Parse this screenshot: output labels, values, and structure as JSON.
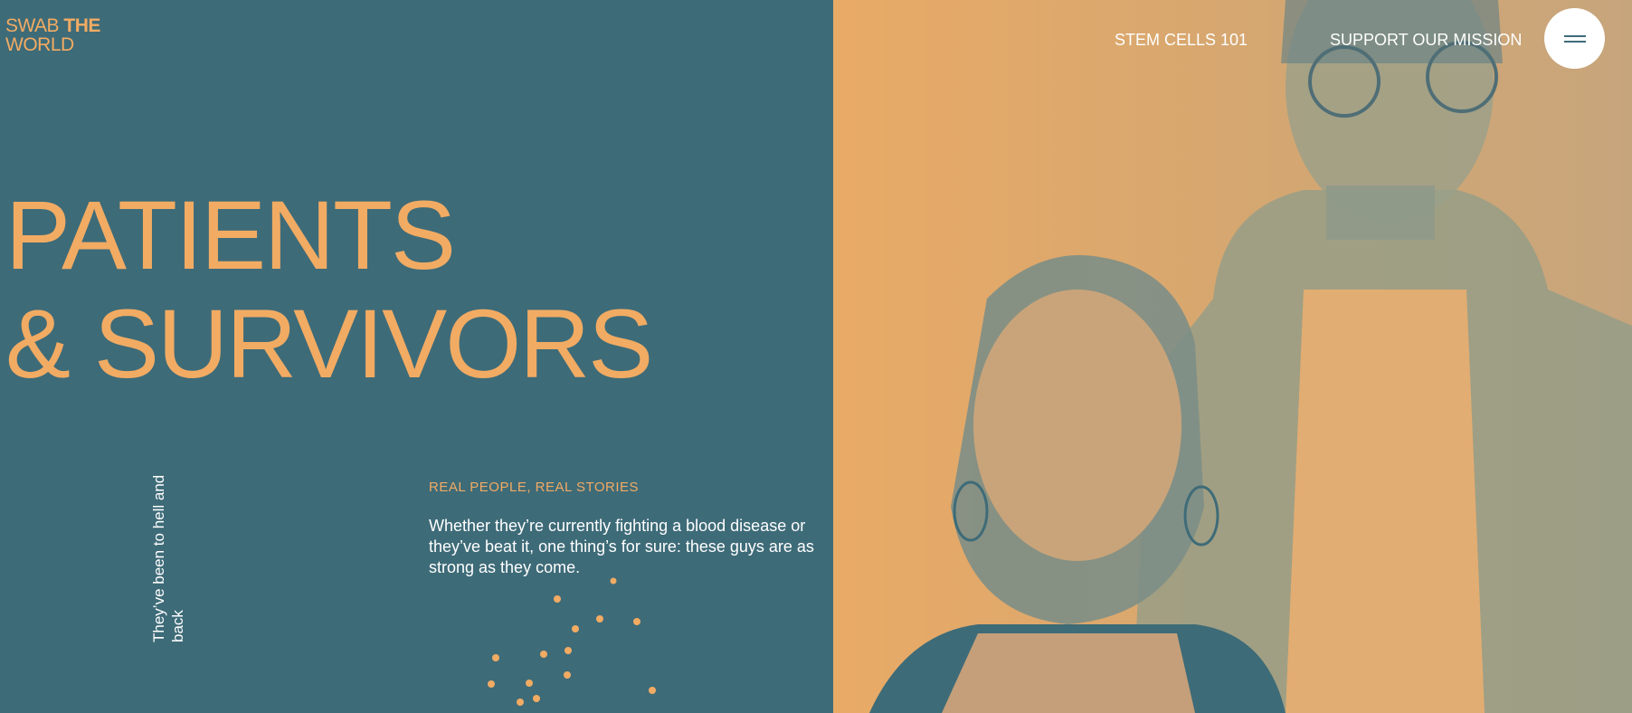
{
  "brand": {
    "logo_line1_a": "SWAB ",
    "logo_line1_b": "THE",
    "logo_line2": "WORLD"
  },
  "nav": {
    "stem_cells": "STEM CELLS 101",
    "support": "SUPPORT OUR MISSION",
    "menu_icon": "hamburger-menu-icon"
  },
  "hero": {
    "title_line1": "PATIENTS",
    "title_line2": "& SURVIVORS",
    "vertical_caption": "They’ve been to hell and back",
    "eyebrow": "REAL PEOPLE, REAL STORIES",
    "intro": "Whether they’re currently fighting a blood disease or they’ve beat it, one thing’s for sure: these guys are as strong as they come."
  },
  "photo": {
    "subject": "duotone-portrait-woman-and-man"
  },
  "colors": {
    "teal": "#3e6b78",
    "orange": "#f2ab63",
    "white": "#ffffff"
  }
}
